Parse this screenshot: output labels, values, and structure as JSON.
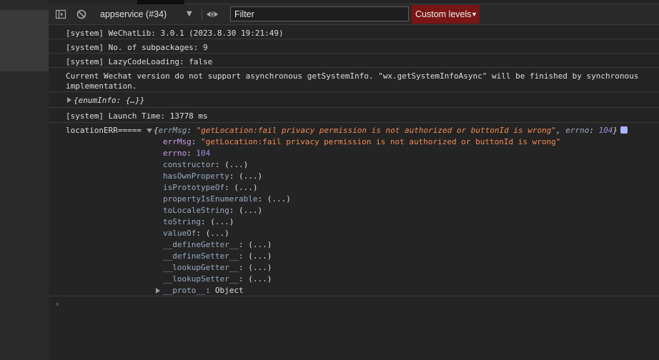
{
  "toolbar": {
    "context": "appservice (#34)",
    "filter_placeholder": "Filter",
    "levels_label": "Custom levels",
    "levels_caret": "▼"
  },
  "logs": [
    "[system] WeChatLib: 3.0.1 (2023.8.30 19:21:49)",
    "[system] No. of subpackages: 9",
    "[system] LazyCodeLoading: false",
    "Current Wechat version do not support asynchronous getSystemInfo. \"wx.getSystemInfoAsync\" will be finished by synchronous implementation.",
    "{enumInfo: {…}}",
    "[system] Launch Time: 13778 ms"
  ],
  "error": {
    "label": "locationERR=====",
    "open": "{",
    "summary_key1": "errMsg",
    "colon_sep": ": ",
    "summary_val1": "\"getLocation:fail privacy permission is not authorized or buttonId is wrong\"",
    "comma": ", ",
    "summary_key2": "errno",
    "summary_val2": "104",
    "close": "}",
    "props": [
      {
        "key": "errMsg",
        "sep": ": ",
        "value": "\"getLocation:fail privacy permission is not authorized or buttonId is wrong\""
      },
      {
        "key": "errno",
        "sep": ": ",
        "value": "104"
      },
      {
        "key": "constructor",
        "sep": ": ",
        "value": "(...)"
      },
      {
        "key": "hasOwnProperty",
        "sep": ": ",
        "value": "(...)"
      },
      {
        "key": "isPrototypeOf",
        "sep": ": ",
        "value": "(...)"
      },
      {
        "key": "propertyIsEnumerable",
        "sep": ": ",
        "value": "(...)"
      },
      {
        "key": "toLocaleString",
        "sep": ": ",
        "value": "(...)"
      },
      {
        "key": "toString",
        "sep": ": ",
        "value": "(...)"
      },
      {
        "key": "valueOf",
        "sep": ": ",
        "value": "(...)"
      },
      {
        "key": "__defineGetter__",
        "sep": ": ",
        "value": "(...)"
      },
      {
        "key": "__defineSetter__",
        "sep": ": ",
        "value": "(...)"
      },
      {
        "key": "__lookupGetter__",
        "sep": ": ",
        "value": "(...)"
      },
      {
        "key": "__lookupSetter__",
        "sep": ": ",
        "value": "(...)"
      },
      {
        "key": "__proto__",
        "sep": ": ",
        "value": "Object"
      }
    ]
  },
  "prompt": "›"
}
